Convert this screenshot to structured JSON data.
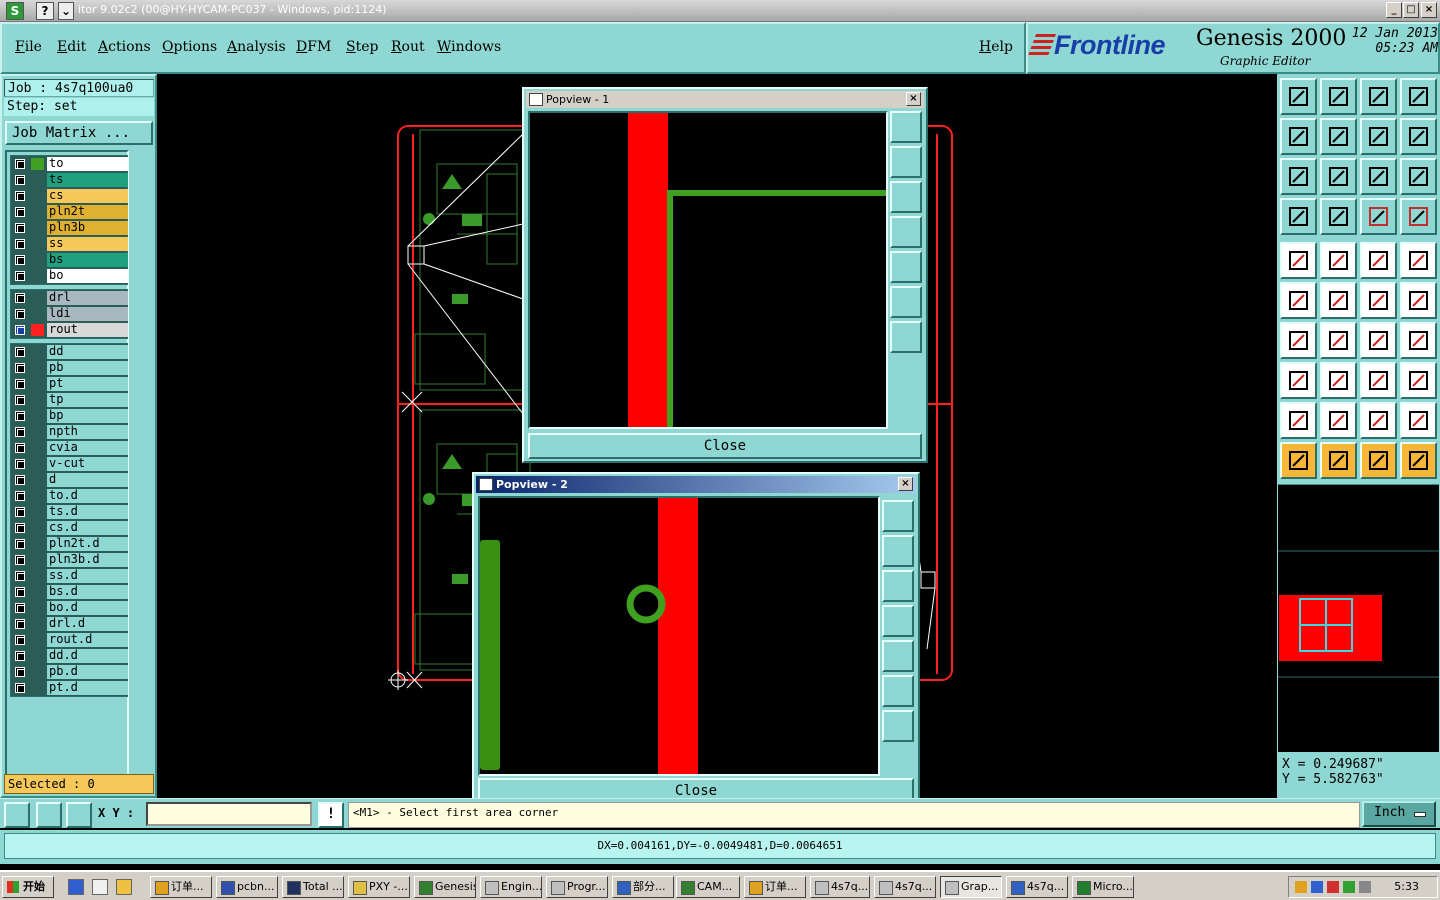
{
  "window": {
    "title": "itor 9.02c2 (00@HY-HYCAM-PC037 - Windows, pid:1124)",
    "controls": [
      "_",
      "□",
      "×"
    ]
  },
  "menu": [
    "File",
    "Edit",
    "Actions",
    "Options",
    "Analysis",
    "DFM",
    "Step",
    "Rout",
    "Windows"
  ],
  "help_label": "Help",
  "brand": {
    "logo": "Frontline",
    "product": "Genesis 2000",
    "subtitle": "Graphic Editor",
    "date": "12 Jan 2013",
    "time": "05:23 AM"
  },
  "job": {
    "job_line": "Job : 4s7q100ua0",
    "step_line": "Step: set",
    "matrix_button": "Job Matrix ..."
  },
  "layer_groups": [
    [
      {
        "name": "to",
        "swatch": "#40a020",
        "bg": "#ffffff"
      },
      {
        "name": "ts",
        "swatch": "#2a5c58",
        "bg": "#20a080"
      },
      {
        "name": "cs",
        "swatch": "#2a5c58",
        "bg": "#f5c85a"
      },
      {
        "name": "pln2t",
        "swatch": "#2a5c58",
        "bg": "#e0b030"
      },
      {
        "name": "pln3b",
        "swatch": "#2a5c58",
        "bg": "#e0b030"
      },
      {
        "name": "ss",
        "swatch": "#2a5c58",
        "bg": "#f5c85a"
      },
      {
        "name": "bs",
        "swatch": "#2a5c58",
        "bg": "#20a080"
      },
      {
        "name": "bo",
        "swatch": "#2a5c58",
        "bg": "#ffffff"
      }
    ],
    [
      {
        "name": "drl",
        "swatch": "#2a5c58",
        "bg": "#a8b8c0"
      },
      {
        "name": "ldi",
        "swatch": "#2a5c58",
        "bg": "#a8b8c0"
      },
      {
        "name": "rout",
        "swatch": "#ff2020",
        "bg": "#d8d8d8",
        "active": true
      }
    ],
    [
      {
        "name": "dd",
        "swatch": "#2a5c58",
        "bg": "#8fd7d2"
      },
      {
        "name": "pb",
        "swatch": "#2a5c58",
        "bg": "#8fd7d2"
      },
      {
        "name": "pt",
        "swatch": "#2a5c58",
        "bg": "#8fd7d2"
      },
      {
        "name": "tp",
        "swatch": "#2a5c58",
        "bg": "#8fd7d2"
      },
      {
        "name": "bp",
        "swatch": "#2a5c58",
        "bg": "#8fd7d2"
      },
      {
        "name": "npth",
        "swatch": "#2a5c58",
        "bg": "#8fd7d2"
      },
      {
        "name": "cvia",
        "swatch": "#2a5c58",
        "bg": "#8fd7d2"
      },
      {
        "name": "v-cut",
        "swatch": "#2a5c58",
        "bg": "#8fd7d2"
      },
      {
        "name": "d",
        "swatch": "#2a5c58",
        "bg": "#8fd7d2"
      },
      {
        "name": "to.d",
        "swatch": "#2a5c58",
        "bg": "#8fd7d2"
      },
      {
        "name": "ts.d",
        "swatch": "#2a5c58",
        "bg": "#8fd7d2"
      },
      {
        "name": "cs.d",
        "swatch": "#2a5c58",
        "bg": "#8fd7d2"
      },
      {
        "name": "pln2t.d",
        "swatch": "#2a5c58",
        "bg": "#8fd7d2"
      },
      {
        "name": "pln3b.d",
        "swatch": "#2a5c58",
        "bg": "#8fd7d2"
      },
      {
        "name": "ss.d",
        "swatch": "#2a5c58",
        "bg": "#8fd7d2"
      },
      {
        "name": "bs.d",
        "swatch": "#2a5c58",
        "bg": "#8fd7d2"
      },
      {
        "name": "bo.d",
        "swatch": "#2a5c58",
        "bg": "#8fd7d2"
      },
      {
        "name": "drl.d",
        "swatch": "#2a5c58",
        "bg": "#8fd7d2"
      },
      {
        "name": "rout.d",
        "swatch": "#2a5c58",
        "bg": "#8fd7d2"
      },
      {
        "name": "dd.d",
        "swatch": "#2a5c58",
        "bg": "#8fd7d2"
      },
      {
        "name": "pb.d",
        "swatch": "#2a5c58",
        "bg": "#8fd7d2"
      },
      {
        "name": "pt.d",
        "swatch": "#2a5c58",
        "bg": "#8fd7d2"
      }
    ]
  ],
  "selected": "Selected : 0",
  "xy_label": "X Y :",
  "xy_input_value": "",
  "bang_label": "!",
  "prompt": "<M1> - Select first area corner",
  "unit": "Inch",
  "measure": "DX=0.004161,DY=-0.0049481,D=0.0064651",
  "coords": {
    "x": "X = 0.249687\"",
    "y": "Y = 5.582763\""
  },
  "popview1": {
    "title": "Popview - 1",
    "close": "Close"
  },
  "popview2": {
    "title": "Popview - 2",
    "close": "Close"
  },
  "taskbar": {
    "start": "开始",
    "tasks": [
      "订单...",
      "pcbn...",
      "Total ...",
      "PXY -...",
      "Genesis",
      "Engin...",
      "Progr...",
      "部分...",
      "CAM...",
      "订单...",
      "4s7q...",
      "4s7q...",
      "Grap...",
      "4s7q...",
      "Micro..."
    ],
    "clock": "5:33"
  },
  "colors": {
    "panel": "#8fd7d2",
    "rout": "#ff2020",
    "trace": "#40a020"
  }
}
